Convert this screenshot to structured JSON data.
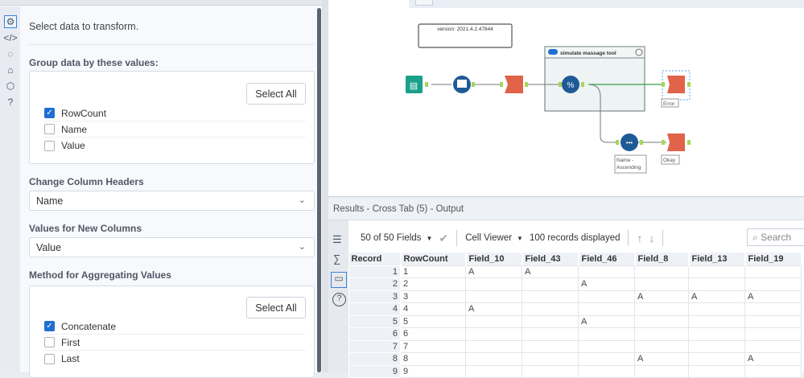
{
  "config": {
    "intro": "Select data to transform.",
    "group_header": "Group data by these values:",
    "select_all": "Select All",
    "group_fields": [
      {
        "label": "RowCount",
        "checked": true
      },
      {
        "label": "Name",
        "checked": false
      },
      {
        "label": "Value",
        "checked": false
      }
    ],
    "headers_label": "Change Column Headers",
    "headers_value": "Name",
    "values_label": "Values for New Columns",
    "values_value": "Value",
    "method_label": "Method for Aggregating Values",
    "methods": [
      {
        "label": "Concatenate",
        "checked": true
      },
      {
        "label": "First",
        "checked": false
      },
      {
        "label": "Last",
        "checked": false
      }
    ]
  },
  "canvas": {
    "version": "version:  2021.4.2.47844",
    "container_title": "simulate massage tool",
    "labels": {
      "error": "Error",
      "sort": "Name -\nAscending",
      "sort1": "Name -",
      "sort2": "Ascending",
      "okay": "Okay"
    }
  },
  "results": {
    "title": "Results - Cross Tab (5) - Output",
    "fields": "50 of 50 Fields",
    "cell_viewer": "Cell Viewer",
    "records": "100 records displayed",
    "search_placeholder": "Search",
    "columns": [
      "Record",
      "RowCount",
      "Field_10",
      "Field_43",
      "Field_46",
      "Field_8",
      "Field_13",
      "Field_19"
    ],
    "rows": [
      [
        "1",
        "1",
        "A",
        "A",
        "",
        "",
        "",
        ""
      ],
      [
        "2",
        "2",
        "",
        "",
        "A",
        "",
        "",
        ""
      ],
      [
        "3",
        "3",
        "",
        "",
        "",
        "A",
        "A",
        "A"
      ],
      [
        "4",
        "4",
        "A",
        "",
        "",
        "",
        "",
        ""
      ],
      [
        "5",
        "5",
        "",
        "",
        "A",
        "",
        "",
        ""
      ],
      [
        "6",
        "6",
        "",
        "",
        "",
        "",
        "",
        ""
      ],
      [
        "7",
        "7",
        "",
        "",
        "",
        "",
        "",
        ""
      ],
      [
        "8",
        "8",
        "",
        "",
        "",
        "A",
        "",
        "A"
      ],
      [
        "9",
        "9",
        "",
        "",
        "",
        "",
        "",
        ""
      ]
    ]
  }
}
